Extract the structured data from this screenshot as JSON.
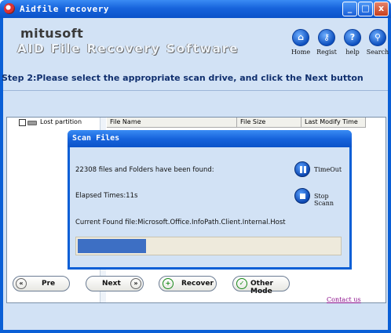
{
  "window": {
    "title": "Aidfile recovery",
    "controls": [
      "_",
      "□",
      "x"
    ]
  },
  "header": {
    "logo": "mitusoft",
    "subtitle": "AID File Recovery Software",
    "nav": [
      {
        "label": "Home",
        "icon": "home-icon"
      },
      {
        "label": "Regist",
        "icon": "key-icon"
      },
      {
        "label": "help",
        "icon": "help-icon"
      },
      {
        "label": "Search",
        "icon": "search-icon"
      }
    ]
  },
  "step_text": "Step 2:Please select the appropriate scan drive, and click the Next button",
  "tree": {
    "item": "Lost partition"
  },
  "file_table": {
    "columns": [
      "File Name",
      "File Size",
      "Last Modify Time"
    ]
  },
  "dialog": {
    "title": "Scan Files",
    "found_text": "22308 files and Folders have been found:",
    "elapsed_text": "Elapsed Times:11s",
    "current_text": "Current Found file:Microsoft.Office.InfoPath.Client.Internal.Host",
    "timeout_label": "TimeOut",
    "stop_label": "Stop Scann",
    "progress": 0.26
  },
  "buttons": {
    "pre": "Pre",
    "next": "Next",
    "recover": "Recover",
    "other_mode": "Other Mode"
  },
  "contact": "Contact us"
}
